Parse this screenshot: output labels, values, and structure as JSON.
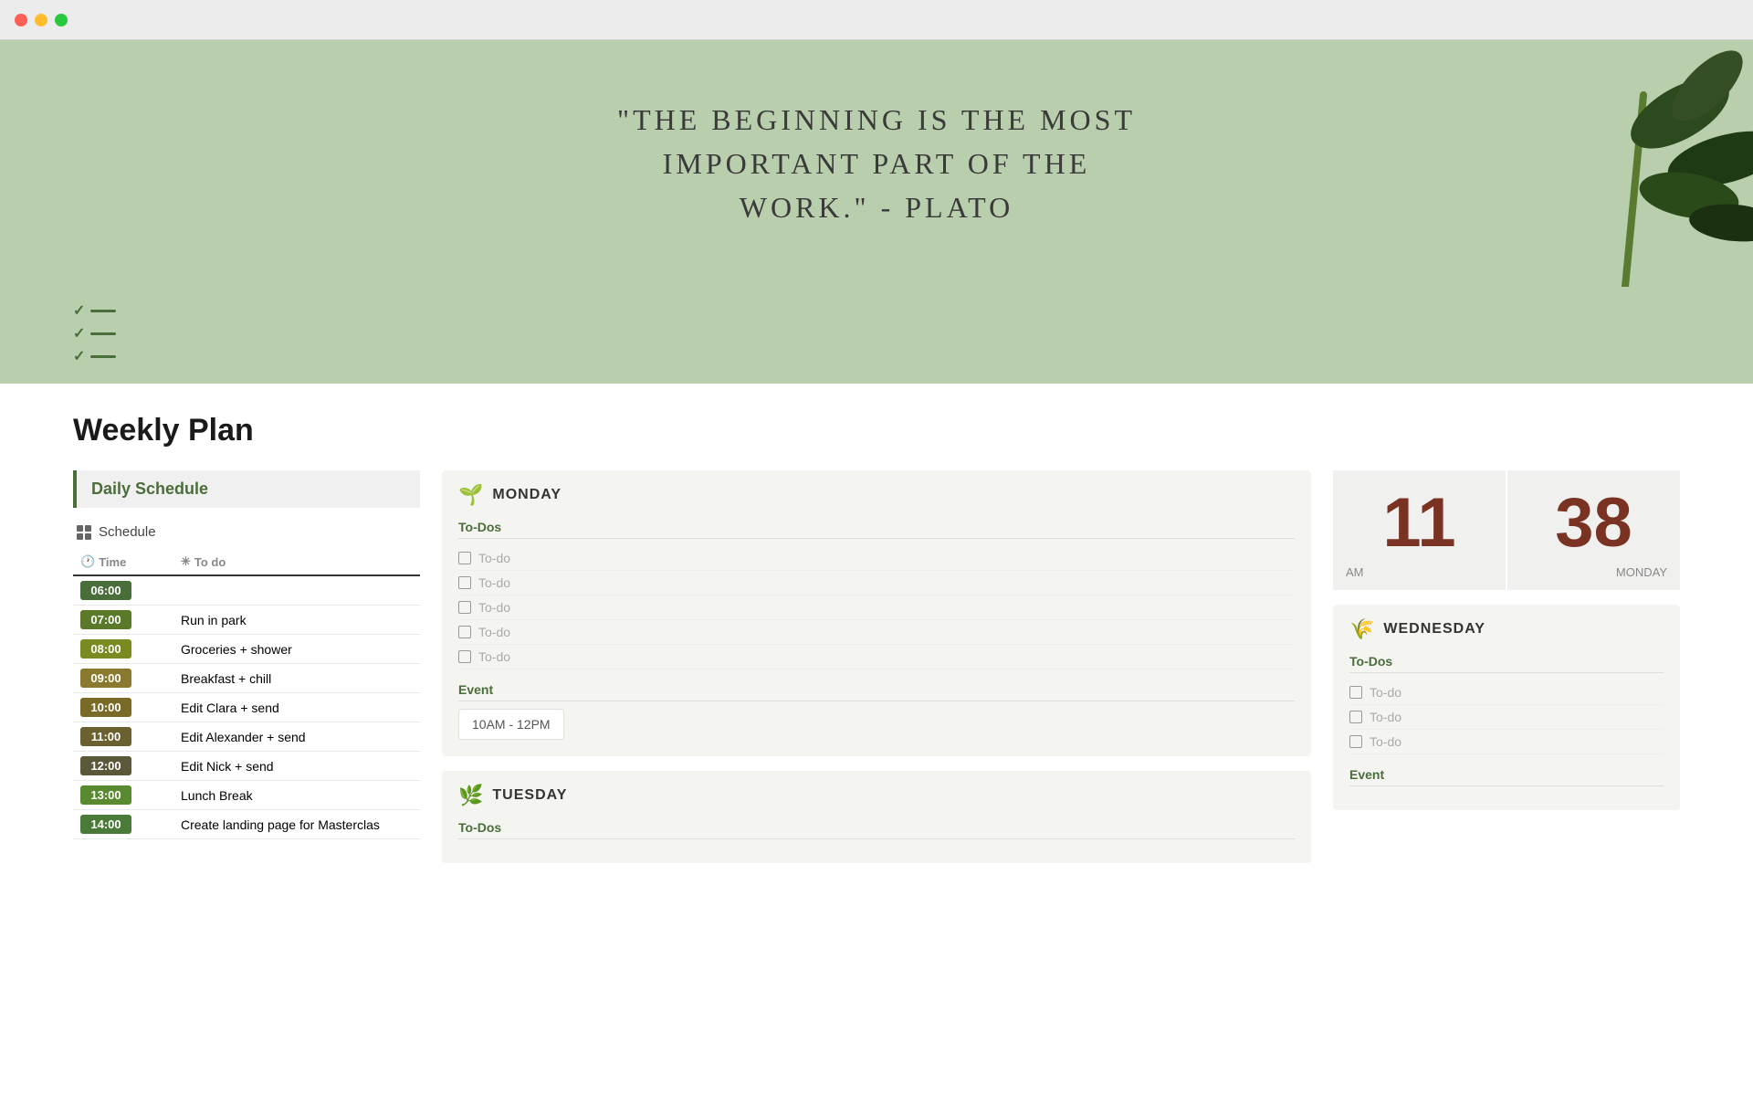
{
  "browser": {
    "traffic_lights": [
      "red",
      "yellow",
      "green"
    ]
  },
  "banner": {
    "quote": "\"The Beginning is the Most\nImportant Part of the\nWork.\" - Plato"
  },
  "page": {
    "title": "Weekly Plan"
  },
  "left_panel": {
    "daily_schedule_label": "Daily Schedule",
    "schedule_section_label": "Schedule",
    "col_time": "Time",
    "col_todo": "To do",
    "rows": [
      {
        "time": "06:00",
        "color": "#4a6e3a",
        "task": ""
      },
      {
        "time": "07:00",
        "color": "#5a7a2a",
        "task": "Run in park"
      },
      {
        "time": "08:00",
        "color": "#7a8a20",
        "task": "Groceries + shower"
      },
      {
        "time": "09:00",
        "color": "#8a7a30",
        "task": "Breakfast + chill"
      },
      {
        "time": "10:00",
        "color": "#7a6a28",
        "task": "Edit Clara + send"
      },
      {
        "time": "11:00",
        "color": "#6a6030",
        "task": "Edit Alexander + send"
      },
      {
        "time": "12:00",
        "color": "#5a5838",
        "task": "Edit Nick + send"
      },
      {
        "time": "13:00",
        "color": "#5a8a30",
        "task": "Lunch Break"
      },
      {
        "time": "14:00",
        "color": "#4a7a38",
        "task": "Create landing page for Masterclas"
      }
    ]
  },
  "monday": {
    "emoji": "🌱",
    "name": "MONDAY",
    "todos_label": "To-Dos",
    "todos": [
      "To-do",
      "To-do",
      "To-do",
      "To-do",
      "To-do"
    ],
    "event_label": "Event",
    "event_time": "10AM - 12PM"
  },
  "tuesday": {
    "emoji": "🌿",
    "name": "TUESDAY",
    "todos_label": "To-Dos",
    "todos": []
  },
  "clock": {
    "hour": "11",
    "minute": "38",
    "am_pm": "AM",
    "day": "MONDAY"
  },
  "wednesday": {
    "emoji": "🌾",
    "name": "WEDNESDAY",
    "todos_label": "To-Dos",
    "todos": [
      "To-do",
      "To-do",
      "To-do"
    ],
    "event_label": "Event"
  }
}
